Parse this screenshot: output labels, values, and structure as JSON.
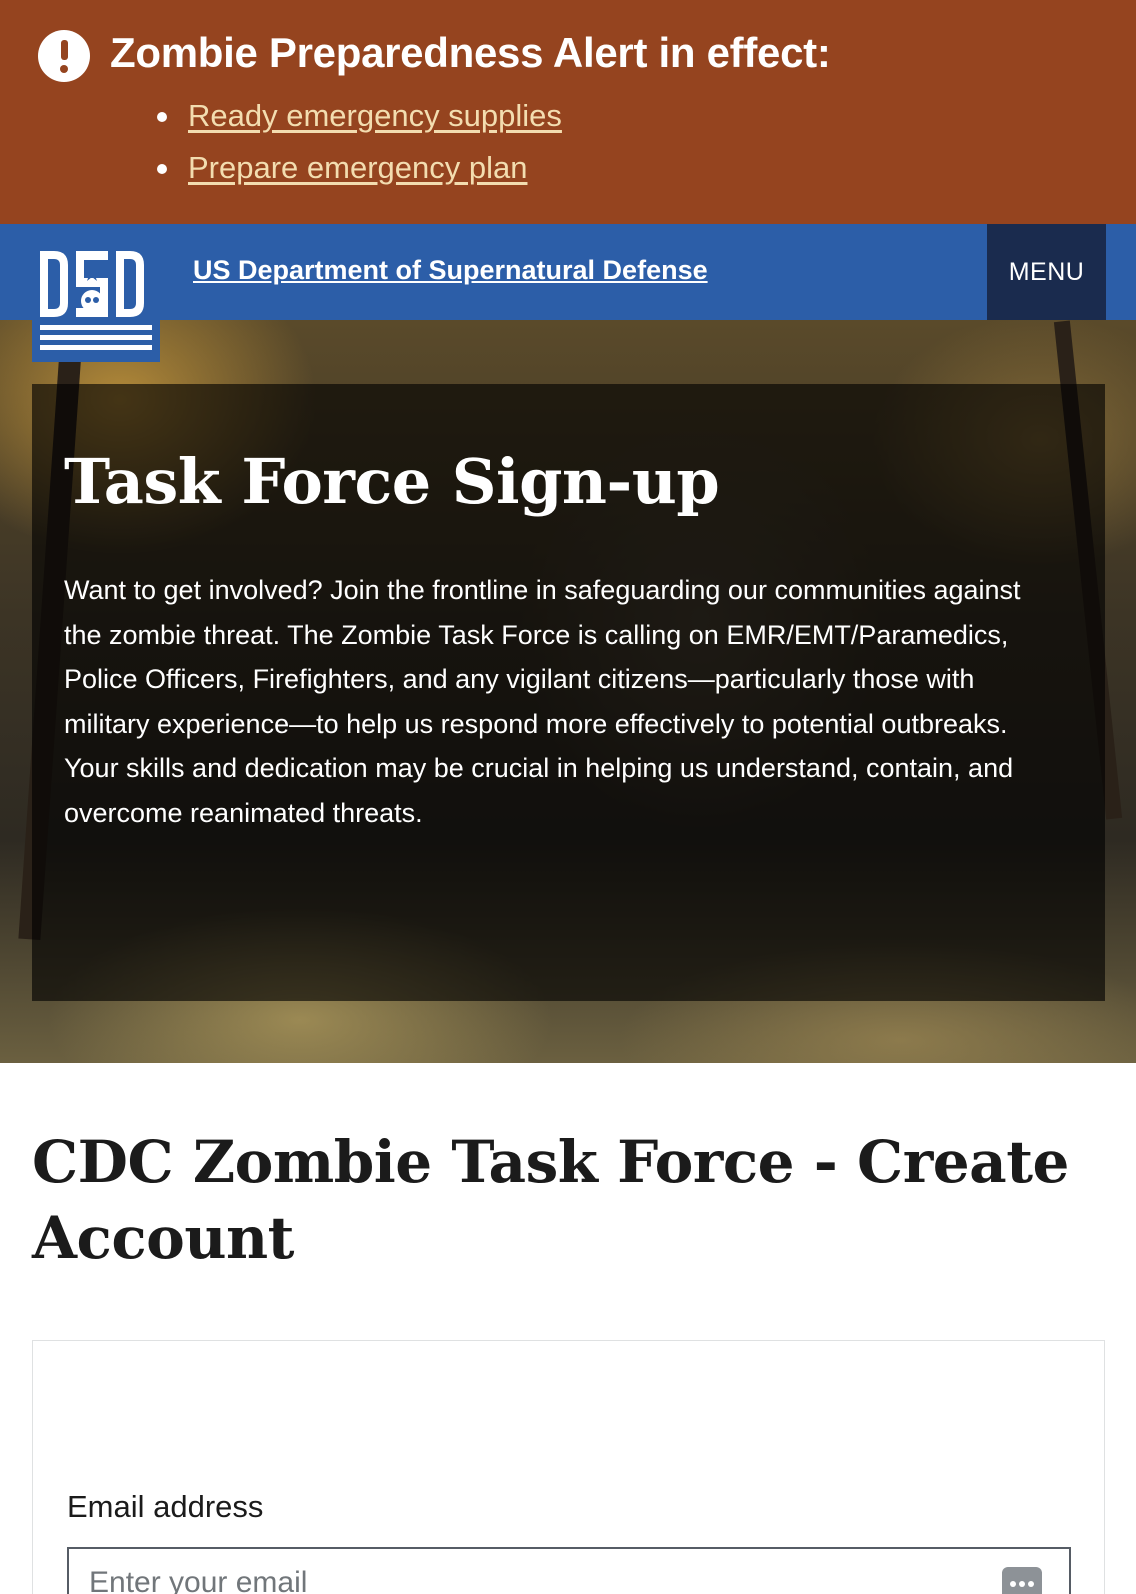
{
  "alert": {
    "title": "Zombie Preparedness Alert in effect:",
    "links": [
      {
        "label": "Ready emergency supplies"
      },
      {
        "label": "Prepare emergency plan"
      }
    ],
    "icon": "exclamation-circle-icon",
    "background_color": "#95441f"
  },
  "header": {
    "logo_text": "DSD",
    "site_title": "US Department of Supernatural Defense",
    "menu_label": "MENU",
    "background_color": "#2c5ea8"
  },
  "hero": {
    "title": "Task Force Sign-up",
    "body": "Want to get involved? Join the frontline in safeguarding our communities against the zombie threat. The Zombie Task Force is calling on EMR/EMT/Paramedics, Police Officers, Firefighters, and any vigilant citizens—particularly those with military experience—to help us respond more effectively to potential outbreaks. Your skills and dedication may be crucial in helping us understand, contain, and overcome reanimated threats."
  },
  "main": {
    "heading": "CDC Zombie Task Force - Create Account",
    "form": {
      "email_label": "Email address",
      "email_placeholder": "Enter your email",
      "email_value": "",
      "autofill_icon": "password-manager-icon"
    }
  }
}
